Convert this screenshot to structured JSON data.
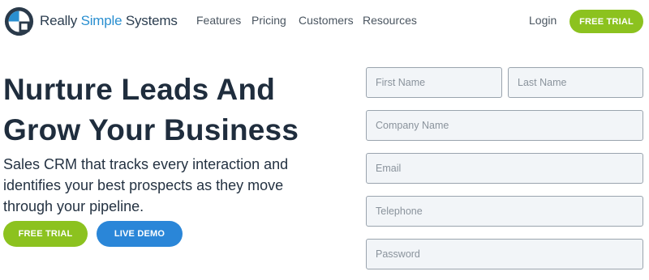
{
  "brand": {
    "name_part1": "Really ",
    "name_part2": "Simple",
    "name_part3": " Systems",
    "colors": {
      "dark": "#2c3e50",
      "accent": "#2a8fd0"
    }
  },
  "nav": {
    "links": [
      "Features",
      "Pricing",
      "Customers",
      "Resources"
    ],
    "login": "Login",
    "cta": "FREE TRIAL"
  },
  "hero": {
    "title": "Nurture Leads And Grow Your Business",
    "subtitle": "Sales CRM that tracks every interaction and identifies your best prospects as they move through your pipeline.",
    "primary_cta": "FREE TRIAL",
    "secondary_cta": "LIVE DEMO"
  },
  "form": {
    "first_name": "First Name",
    "last_name": "Last Name",
    "company": "Company Name",
    "email": "Email",
    "telephone": "Telephone",
    "password": "Password"
  },
  "colors": {
    "green": "#8cc21f",
    "blue": "#2a86d8",
    "heading": "#1f2d3d"
  }
}
